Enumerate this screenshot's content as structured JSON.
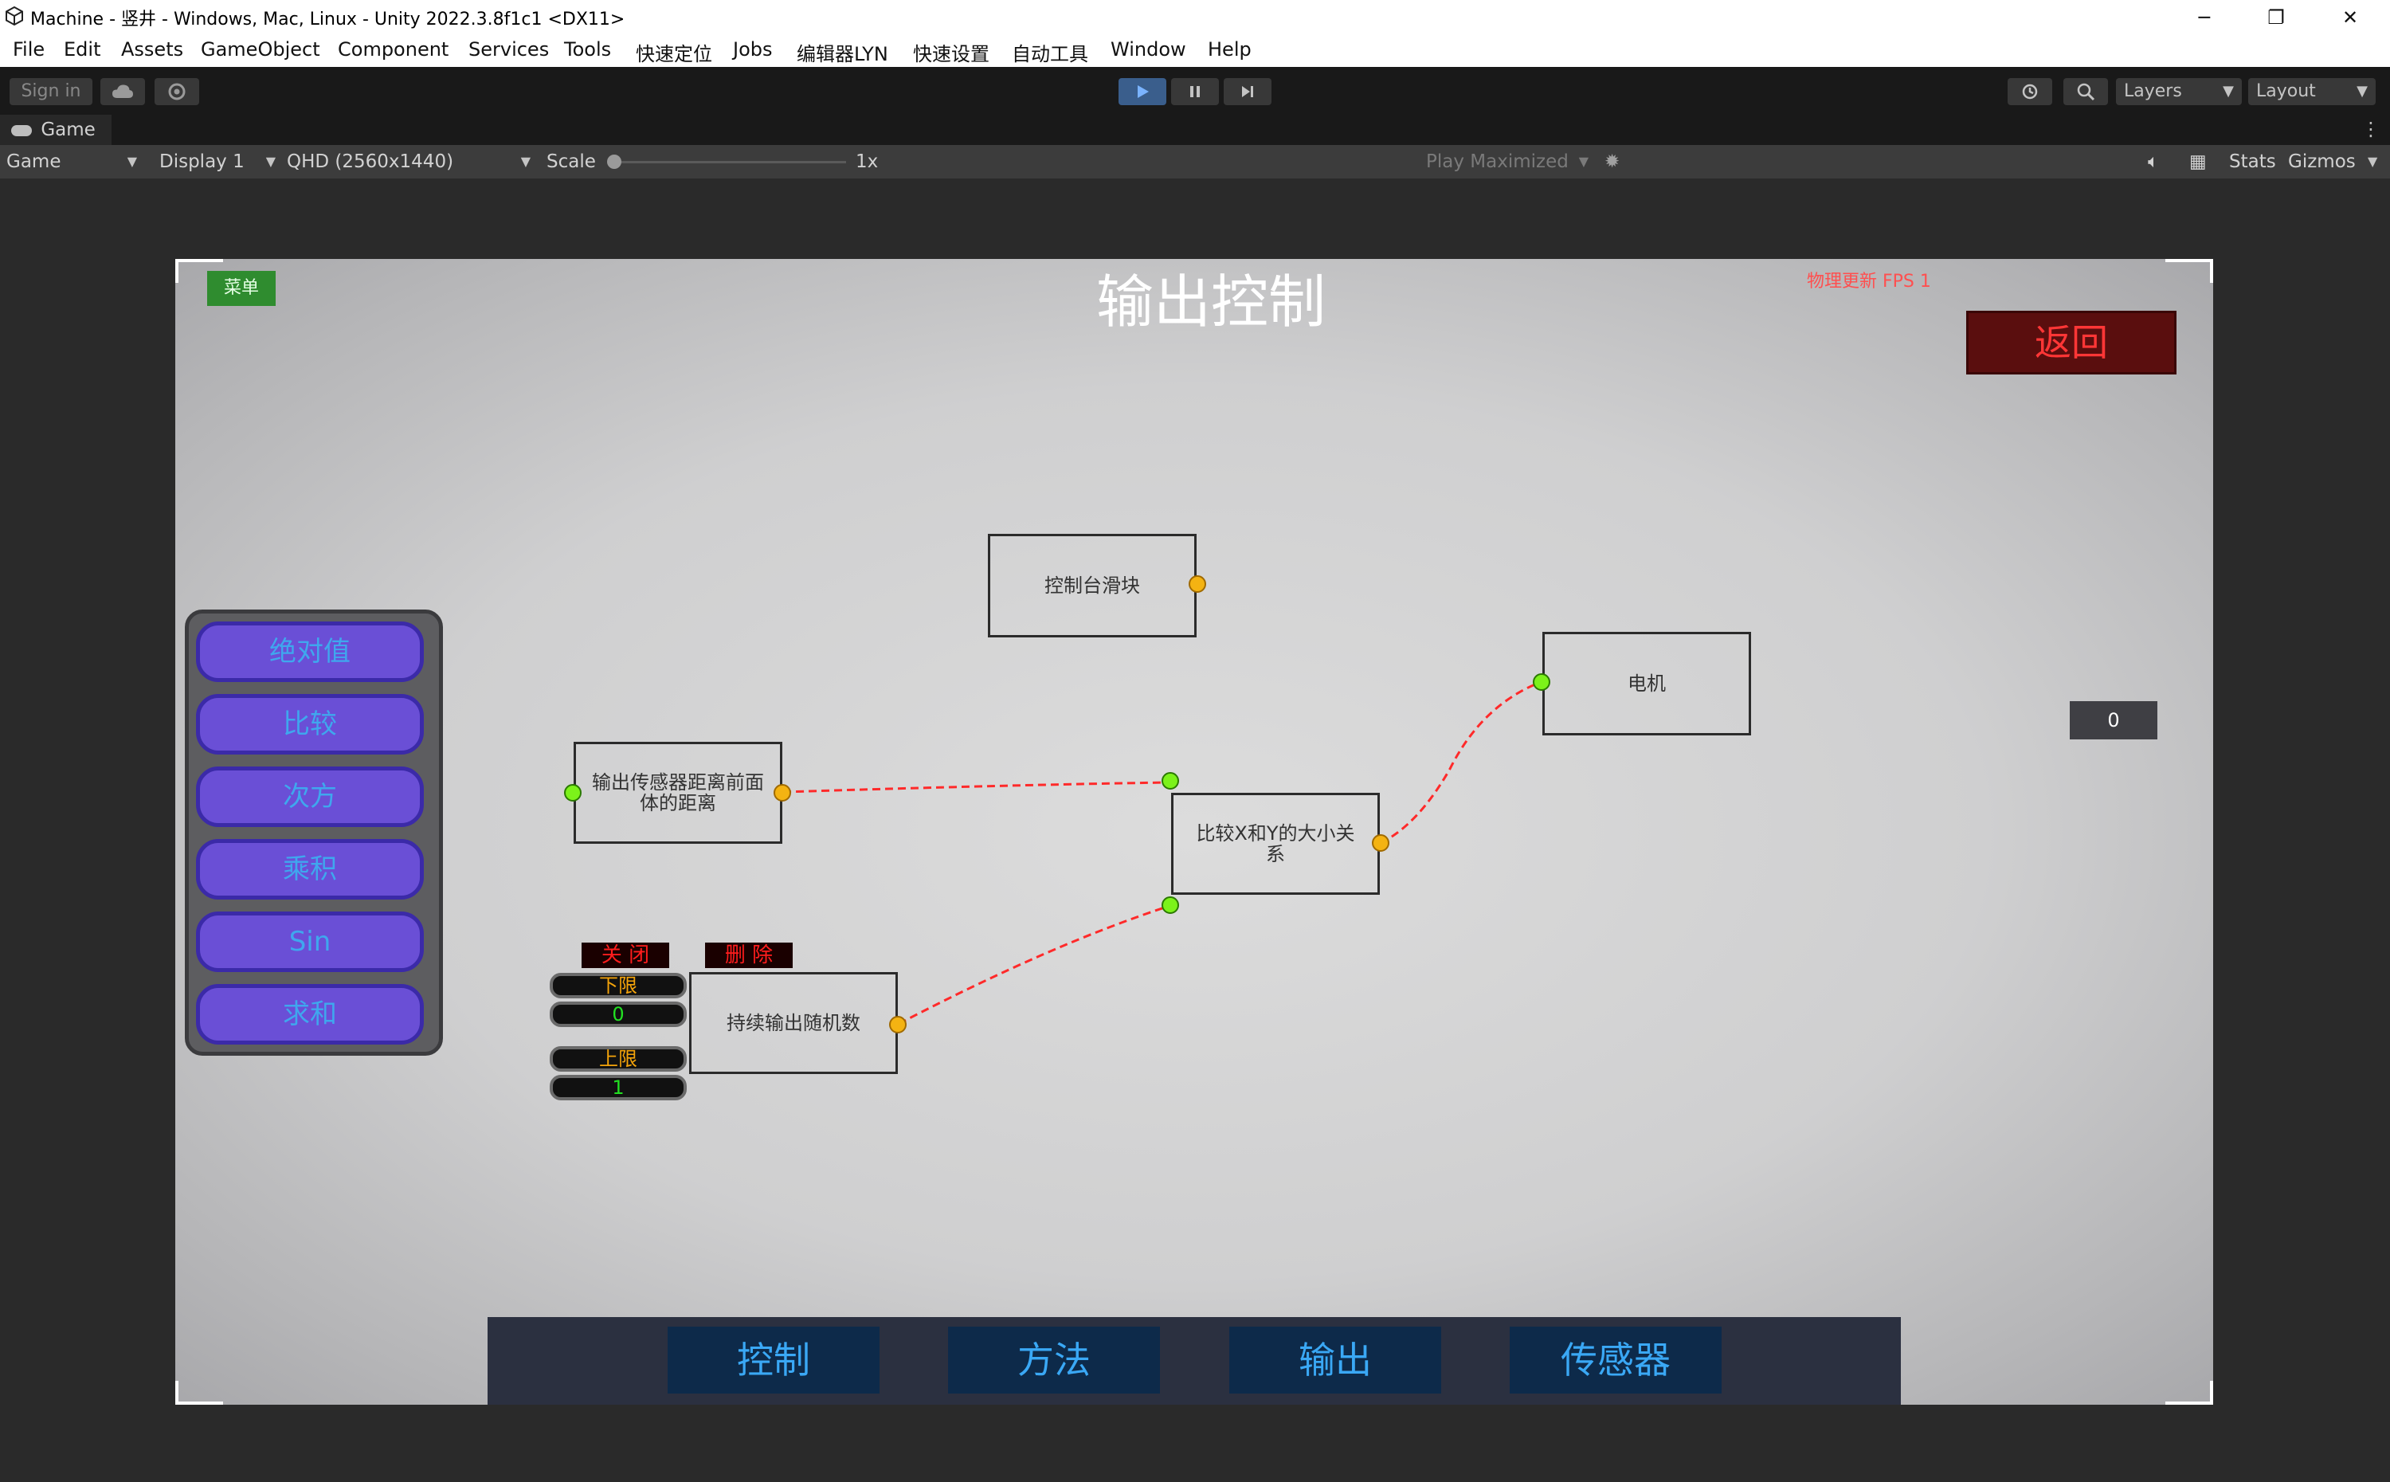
{
  "window": {
    "title": "Machine - 竖井 - Windows, Mac, Linux - Unity 2022.3.8f1c1 <DX11>",
    "minimize": "─",
    "restore": "❐",
    "close": "✕"
  },
  "menubar": [
    "File",
    "Edit",
    "Assets",
    "GameObject",
    "Component",
    "Services",
    "Tools",
    "快速定位",
    "Jobs",
    "编辑器LYN",
    "快速设置",
    "自动工具",
    "Window",
    "Help"
  ],
  "toolbar": {
    "sign_in": "Sign in",
    "layers": "Layers",
    "layout": "Layout",
    "play_state": "playing"
  },
  "game_tab": {
    "label": "Game",
    "mode": "Game",
    "display": "Display 1",
    "resolution": "QHD (2560x1440)",
    "scale_label": "Scale",
    "scale_value": "1x",
    "play_mode": "Play Maximized",
    "stats": "Stats",
    "gizmos": "Gizmos"
  },
  "game": {
    "menu_button": "菜单",
    "title": "输出控制",
    "fps_text": "物理更新 FPS 1",
    "back_button": "返回",
    "value_box": "0",
    "side_buttons": [
      "绝对值",
      "比较",
      "次方",
      "乘积",
      "Sin",
      "求和"
    ],
    "nodes": {
      "slider": "控制台滑块",
      "motor": "电机",
      "distance": "输出传感器距离前面  体的距离",
      "compare": "比较X和Y的大小关系",
      "random": "持续输出随机数"
    },
    "random_controls": {
      "close": "关 闭",
      "delete": "删 除",
      "lower_label": "下限",
      "lower_value": "0",
      "upper_label": "上限",
      "upper_value": "1"
    },
    "bottom_nav": [
      "控制",
      "方法",
      "输出",
      "传感器"
    ],
    "colors": {
      "accent_blue": "#3aa8f5",
      "wire_red": "#ff2a2a",
      "port_green": "#7cf21a",
      "port_yellow": "#f4b312",
      "back_red": "#5a0e0e"
    }
  }
}
